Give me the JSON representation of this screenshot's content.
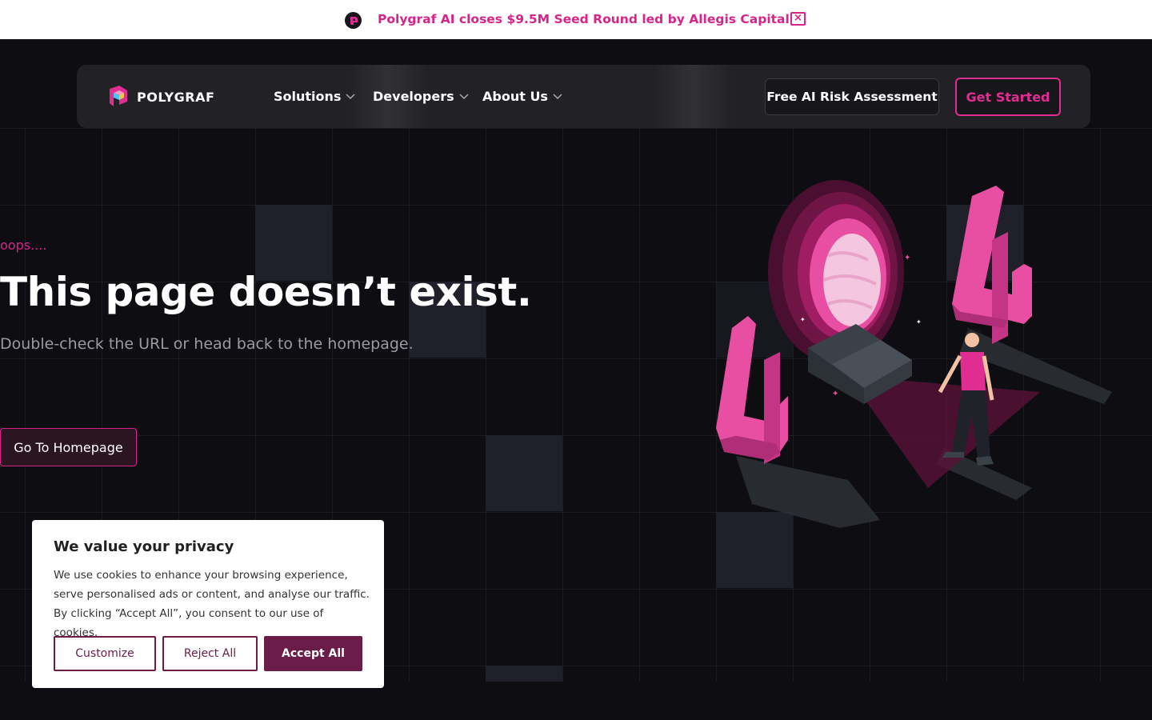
{
  "announcement": {
    "text": "Polygraf AI closes $9.5M Seed Round led by Allegis Capital",
    "close_icon": "close-icon",
    "accent": "#d6248a"
  },
  "nav": {
    "brand": "POLYGRAF",
    "items": [
      {
        "label": "Solutions",
        "icon": "chevron-down-icon"
      },
      {
        "label": "Developers",
        "icon": "chevron-down-icon"
      },
      {
        "label": "About Us",
        "icon": "chevron-down-icon"
      }
    ],
    "secondary_cta": "Free AI Risk Assessment",
    "primary_cta": "Get Started",
    "primary_color": "#e02d92"
  },
  "hero": {
    "eyebrow": "oops....",
    "title": "This page doesn’t exist.",
    "subtitle": "Double-check the URL or head back to the homepage.",
    "button": "Go To Homepage",
    "illustration_icon": "404-illustration"
  },
  "cookie": {
    "title": "We value your privacy",
    "body": "We use cookies to enhance your browsing experience, serve personalised ads or content, and analyse our traffic. By clicking “Accept All”, you consent to our use of cookies.",
    "buttons": {
      "customize": "Customize",
      "reject": "Reject All",
      "accept": "Accept All"
    },
    "button_color": "#6b1c48"
  }
}
